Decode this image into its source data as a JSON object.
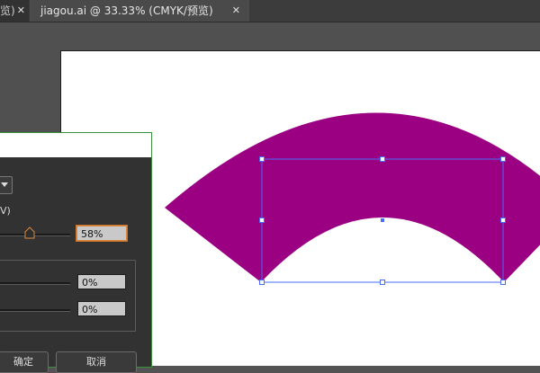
{
  "tabs": {
    "prev": {
      "label": "览)",
      "close": "✕"
    },
    "active": {
      "label": "jiagou.ai @ 33.33% (CMYK/预览)",
      "close": "✕"
    }
  },
  "dialog": {
    "label_v": "V)",
    "opacity_value": "58%",
    "field_a_value": "0%",
    "field_b_value": "0%",
    "ok_label": "确定",
    "cancel_label": "取消"
  },
  "colors": {
    "shape_fill": "#9b0082",
    "selection": "#4a6cf7"
  }
}
